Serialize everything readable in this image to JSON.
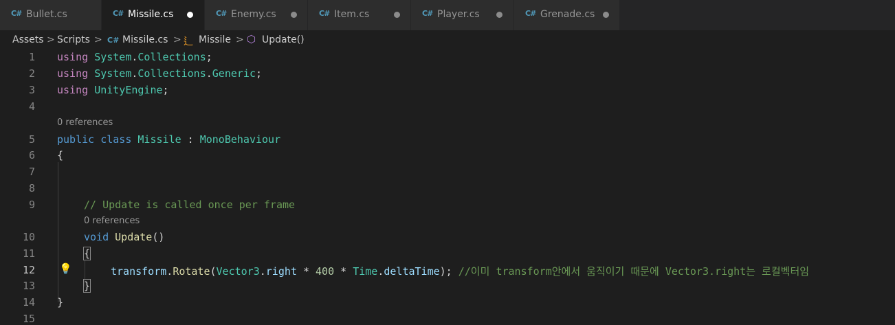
{
  "tabs": [
    {
      "label": "Bullet.cs",
      "icon": "csharp-icon",
      "active": false,
      "modified": false
    },
    {
      "label": "Missile.cs",
      "icon": "csharp-icon",
      "active": true,
      "modified": true
    },
    {
      "label": "Enemy.cs",
      "icon": "csharp-icon",
      "active": false,
      "modified": true
    },
    {
      "label": "Item.cs",
      "icon": "csharp-icon",
      "active": false,
      "modified": true
    },
    {
      "label": "Player.cs",
      "icon": "csharp-icon",
      "active": false,
      "modified": true
    },
    {
      "label": "Grenade.cs",
      "icon": "csharp-icon",
      "active": false,
      "modified": true
    }
  ],
  "tab_icon_glyph": "C#",
  "breadcrumb": {
    "chevron": ">",
    "items": [
      "Assets",
      "Scripts",
      "Missile.cs",
      "Missile",
      "Update()"
    ],
    "file_icon_glyph": "C#",
    "class_icon_glyph": "⻍",
    "method_icon_glyph": "⬡"
  },
  "editor": {
    "line_numbers": [
      "1",
      "2",
      "3",
      "4",
      "5",
      "6",
      "7",
      "8",
      "9",
      "10",
      "11",
      "12",
      "13",
      "14",
      "15"
    ],
    "active_line": "12",
    "codelens": [
      "0 references",
      "0 references"
    ],
    "lines": {
      "l1": [
        "using",
        " ",
        "System",
        ".",
        "Collections",
        ";"
      ],
      "l2": [
        "using",
        " ",
        "System",
        ".",
        "Collections",
        ".",
        "Generic",
        ";"
      ],
      "l3": [
        "using",
        " ",
        "UnityEngine",
        ";"
      ],
      "l5": [
        "public",
        " ",
        "class",
        " ",
        "Missile",
        " : ",
        "MonoBehaviour"
      ],
      "l6": [
        "{"
      ],
      "l9": [
        "// Update is called once per frame"
      ],
      "l10": [
        "void",
        " ",
        "Update",
        "()"
      ],
      "l11": [
        "{"
      ],
      "l12": [
        "transform",
        ".",
        "Rotate",
        "(",
        "Vector3",
        ".",
        "right",
        " * ",
        "400",
        " * ",
        "Time",
        ".",
        "deltaTime",
        "); ",
        "//이미 transform안에서 움직이기 때문에 Vector3.right는 로컬벡터임"
      ],
      "l13": [
        "}"
      ],
      "l14": [
        "}"
      ]
    },
    "lightbulb_glyph": "💡"
  },
  "colors": {
    "background": "#1e1e1e",
    "keyword_control": "#c586c0",
    "keyword": "#569cd6",
    "type": "#4ec9b0",
    "function": "#dcdcaa",
    "variable": "#9cdcfe",
    "number": "#b5cea8",
    "comment": "#6a9955"
  }
}
